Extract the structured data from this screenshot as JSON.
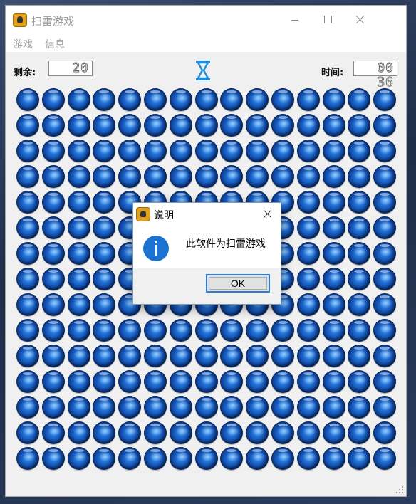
{
  "window": {
    "title": "扫雷游戏",
    "icon": "minesweeper-app-icon"
  },
  "menu": {
    "items": [
      "游戏",
      "信息"
    ]
  },
  "status": {
    "remaining_label": "剩余:",
    "remaining_value": "20",
    "time_label": "时间:",
    "time_value": "00 36",
    "timer_icon": "hourglass-icon"
  },
  "board": {
    "rows": 15,
    "cols": 15,
    "cell_state": "unrevealed",
    "cell_icon": "blue-sphere-icon"
  },
  "dialog": {
    "title": "说明",
    "icon": "info-icon",
    "message": "此软件为扫雷游戏",
    "ok_label": "OK"
  },
  "colors": {
    "accent": "#2b7cd3",
    "sphere": "#1c63c8",
    "info": "#1a73d1"
  }
}
